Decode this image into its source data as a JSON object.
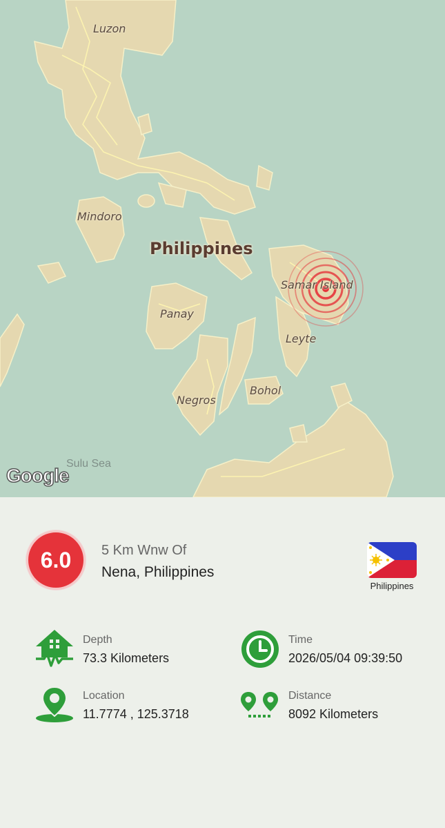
{
  "map": {
    "country_label": "Philippines",
    "labels": {
      "luzon": "Luzon",
      "mindoro": "Mindoro",
      "panay": "Panay",
      "negros": "Negros",
      "bohol": "Bohol",
      "samar": "Samar Island",
      "leyte": "Leyte",
      "sulu_sea": "Sulu Sea"
    },
    "google_logo": "Google",
    "colors": {
      "water": "#b8d4c4",
      "land": "#e5d8b0",
      "roads": "#fff6b0",
      "epicenter": "#e5333a"
    }
  },
  "quake": {
    "magnitude": "6.0",
    "distance_text": "5 Km Wnw Of",
    "place": "Nena, Philippines",
    "country": "Philippines"
  },
  "details": {
    "depth_label": "Depth",
    "depth_value": "73.3 Kilometers",
    "time_label": "Time",
    "time_value": "2026/05/04 09:39:50",
    "location_label": "Location",
    "location_value": "11.7774 , 125.3718",
    "distance_label": "Distance",
    "distance_value": "8092 Kilometers"
  },
  "icons": {
    "depth": "house-quake-icon",
    "time": "clock-icon",
    "location": "map-pin-icon",
    "distance": "route-pins-icon",
    "accent": "#2e9e3a"
  }
}
